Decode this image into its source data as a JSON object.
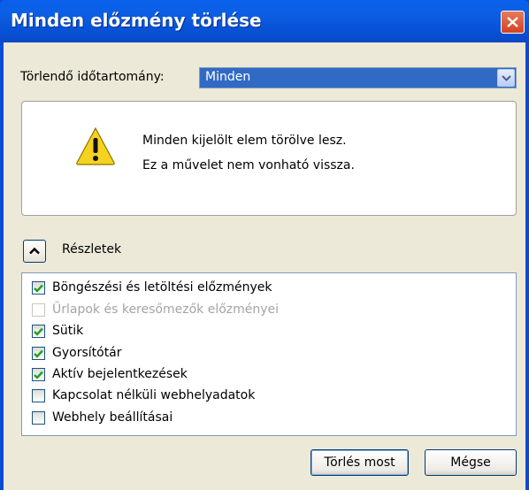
{
  "window": {
    "title": "Minden előzmény törlése",
    "close_icon": "close-icon"
  },
  "range": {
    "label": "Törlendő időtartomány:",
    "selected": "Minden"
  },
  "warning": {
    "icon": "warning-icon",
    "line1": "Minden kijelölt elem törölve lesz.",
    "line2": "Ez a művelet nem vonható vissza."
  },
  "details": {
    "label": "Részletek",
    "toggle_icon": "chevron-up-icon"
  },
  "items": [
    {
      "label": "Böngészési és letöltési előzmények",
      "checked": true,
      "disabled": false
    },
    {
      "label": "Űrlapok és keresőmezők előzményei",
      "checked": false,
      "disabled": true
    },
    {
      "label": "Sütik",
      "checked": true,
      "disabled": false
    },
    {
      "label": "Gyorsítótár",
      "checked": true,
      "disabled": false
    },
    {
      "label": "Aktív bejelentkezések",
      "checked": true,
      "disabled": false
    },
    {
      "label": "Kapcsolat nélküli webhelyadatok",
      "checked": false,
      "disabled": false
    },
    {
      "label": "Webhely beállításai",
      "checked": false,
      "disabled": false
    }
  ],
  "buttons": {
    "delete": "Törlés most",
    "cancel": "Mégse"
  },
  "colors": {
    "titlebar": "#0a4ad7",
    "selection": "#316ac5",
    "dialog_bg": "#ece9d8",
    "check": "#21a121"
  }
}
